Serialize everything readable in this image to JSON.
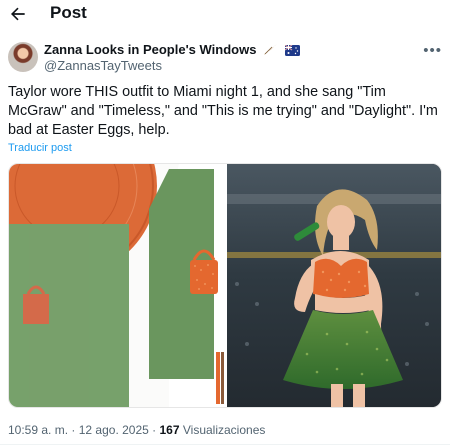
{
  "header": {
    "title": "Post"
  },
  "author": {
    "name": "Zanna Looks in People's Windows",
    "handle": "@ZannasTayTweets",
    "emojis": [
      "feather-emoji",
      "australia-flag-emoji"
    ]
  },
  "post": {
    "text": "Taylor wore THIS outfit to Miami night 1, and she sang \"Tim McGraw\" and \"Timeless,\" and \"This is me trying\" and \"Daylight\". I'm bad at Easter Eggs, help.",
    "translate_label": "Traducir post"
  },
  "media": {
    "left_description": "collage with orange vinyl, green panels and orange sequin purse",
    "right_description": "performer in orange sequin top and green sequin skirt with microphone"
  },
  "meta": {
    "time": "10:59 a. m.",
    "separator": "·",
    "date": "12 ago. 2025",
    "views_count": "167",
    "views_label": "Visualizaciones"
  },
  "colors": {
    "text": "#0f1419",
    "secondary": "#536471",
    "link": "#1d9bf0",
    "orange": "#e4682f",
    "green": "#4f7f46"
  }
}
